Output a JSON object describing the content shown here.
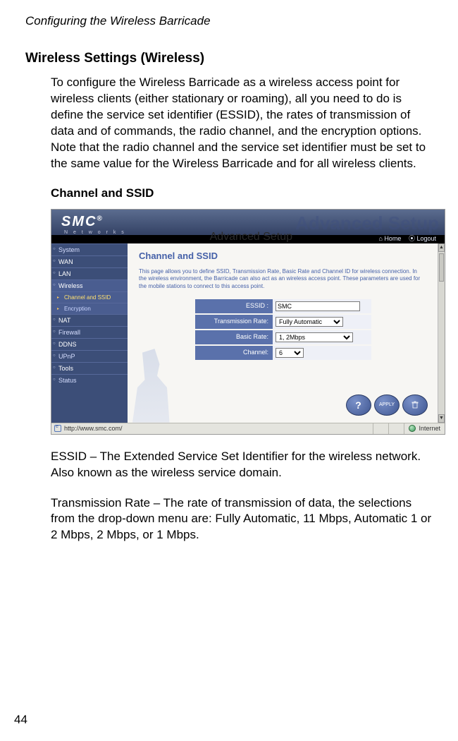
{
  "running_head": "Configuring the Wireless Barricade",
  "section_title": "Wireless Settings (Wireless)",
  "intro_paragraph": "To configure the Wireless Barricade as a wireless access point for wireless clients (either stationary or roaming), all you need to do is define the service set identifier (ESSID), the rates of transmission of data and of commands, the radio channel, and the encryption options. Note that the radio channel and the service set identifier must be set to the same value for the Wireless Barricade and for all wireless clients.",
  "subsection_title": "Channel and SSID",
  "essid_paragraph": "ESSID – The Extended Service Set Identifier for the wireless network. Also known as the wireless service domain.",
  "txrate_paragraph": "Transmission Rate – The rate of transmission of data, the selections from the drop-down menu are: Fully Automatic, 11 Mbps, Automatic 1 or 2 Mbps, 2 Mbps, or 1 Mbps.",
  "page_number": "44",
  "screenshot": {
    "brand": "SMC",
    "brand_sub": "N e t w o r k s",
    "watermark": "Advanced Setup",
    "breadcrumb": "Advanced Setup",
    "home": "Home",
    "logout": "Logout",
    "sidebar": {
      "items": [
        {
          "label": "System"
        },
        {
          "label": "WAN"
        },
        {
          "label": "LAN"
        },
        {
          "label": "Wireless"
        },
        {
          "label": "Channel and SSID"
        },
        {
          "label": "Encryption"
        },
        {
          "label": "NAT"
        },
        {
          "label": "Firewall"
        },
        {
          "label": "DDNS"
        },
        {
          "label": "UPnP"
        },
        {
          "label": "Tools"
        },
        {
          "label": "Status"
        }
      ]
    },
    "panel": {
      "title": "Channel and SSID",
      "description": "This page allows you to define SSID, Transmission Rate, Basic Rate and Channel ID for wireless connection. In the wireless environment, the Barricade can also act as an wireless access point. These parameters are used for the mobile stations to connect to this access point.",
      "fields": {
        "essid_label": "ESSID :",
        "essid_value": "SMC",
        "txrate_label": "Transmission Rate:",
        "txrate_value": "Fully Automatic",
        "basicrate_label": "Basic Rate:",
        "basicrate_value": "1, 2Mbps",
        "channel_label": "Channel:",
        "channel_value": "6"
      },
      "buttons": {
        "help": "HELP",
        "apply": "APPLY",
        "cancel": "CANCEL"
      }
    },
    "statusbar": {
      "url": "http://www.smc.com/",
      "zone": "Internet"
    }
  }
}
